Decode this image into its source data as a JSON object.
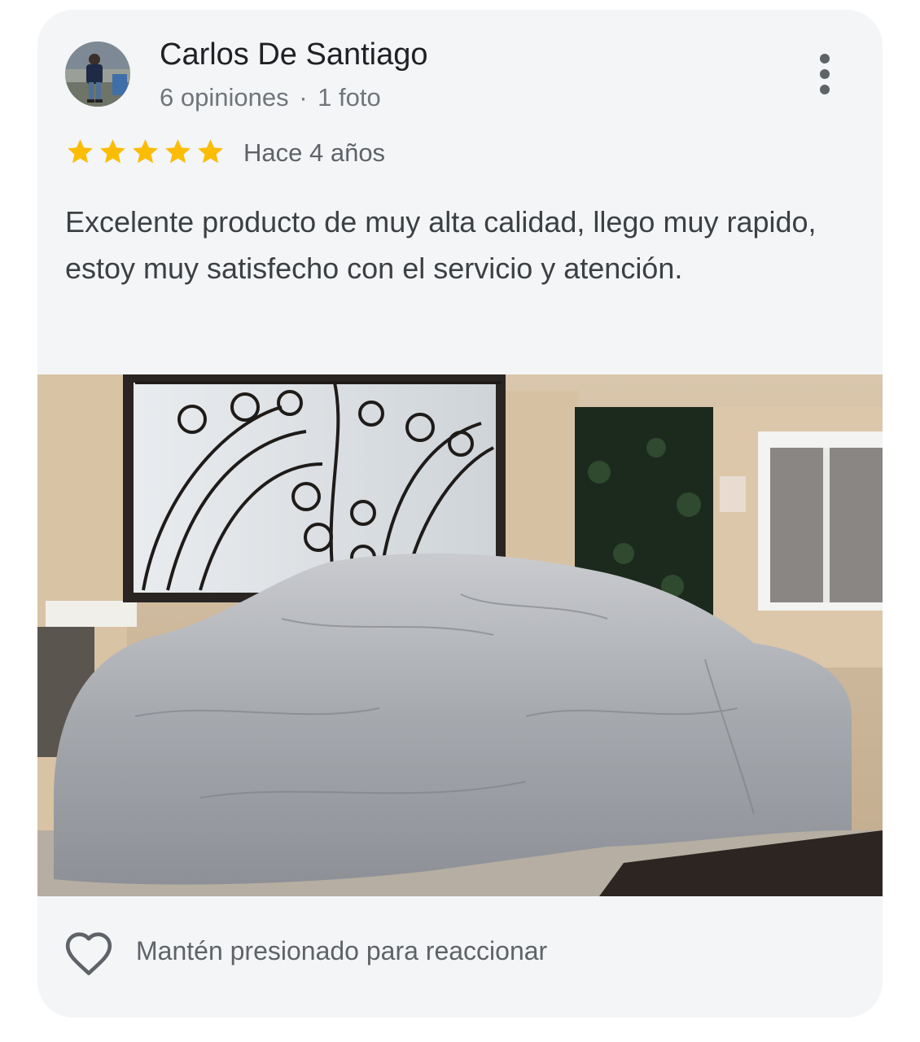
{
  "reviewer": {
    "name": "Carlos De Santiago",
    "reviews_count": "6 opiniones",
    "separator": "·",
    "photos_count": "1 foto"
  },
  "rating": {
    "stars": 5,
    "max_stars": 5,
    "star_color": "#fbbc04",
    "time_ago": "Hace 4 años"
  },
  "review_text": "Excelente producto de muy alta calidad, llego muy rapido, estoy muy satisfecho con el servicio y atención.",
  "footer": {
    "reaction_hint": "Mantén presionado para reaccionar"
  },
  "icons": {
    "more": "more-vert-icon",
    "like": "heart-outline-icon"
  }
}
